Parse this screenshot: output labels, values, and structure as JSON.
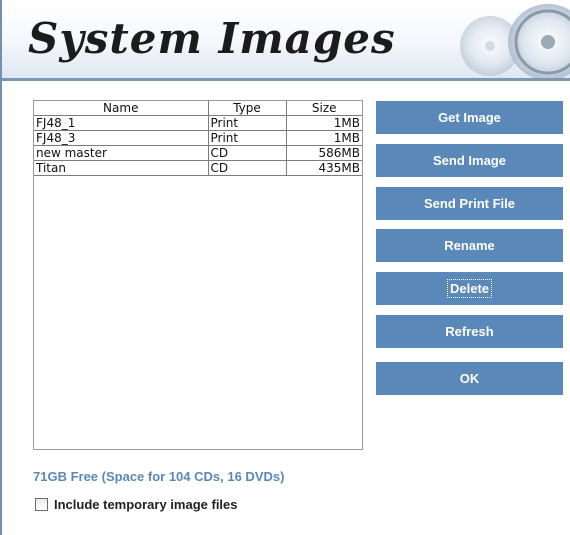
{
  "header": {
    "title": "System Images"
  },
  "file_list": {
    "columns": [
      "Name",
      "Type",
      "Size"
    ],
    "rows": [
      {
        "name": "FJ48_1",
        "type": "Print",
        "size": "1MB"
      },
      {
        "name": "FJ48_3",
        "type": "Print",
        "size": "1MB"
      },
      {
        "name": "new master",
        "type": "CD",
        "size": "586MB"
      },
      {
        "name": "Titan",
        "type": "CD",
        "size": "435MB"
      }
    ]
  },
  "buttons": {
    "get_image": "Get Image",
    "send_image": "Send Image",
    "send_print_file": "Send Print File",
    "rename": "Rename",
    "delete": "Delete",
    "refresh": "Refresh",
    "ok": "OK"
  },
  "status": {
    "free_space": "71GB Free (Space for 104 CDs, 16 DVDs)"
  },
  "options": {
    "include_temp_label": "Include temporary image files",
    "include_temp_checked": false
  },
  "colors": {
    "accent": "#5a88b8",
    "header_border": "#7d97b7"
  },
  "icons": {
    "header_art": "disc-icon"
  }
}
